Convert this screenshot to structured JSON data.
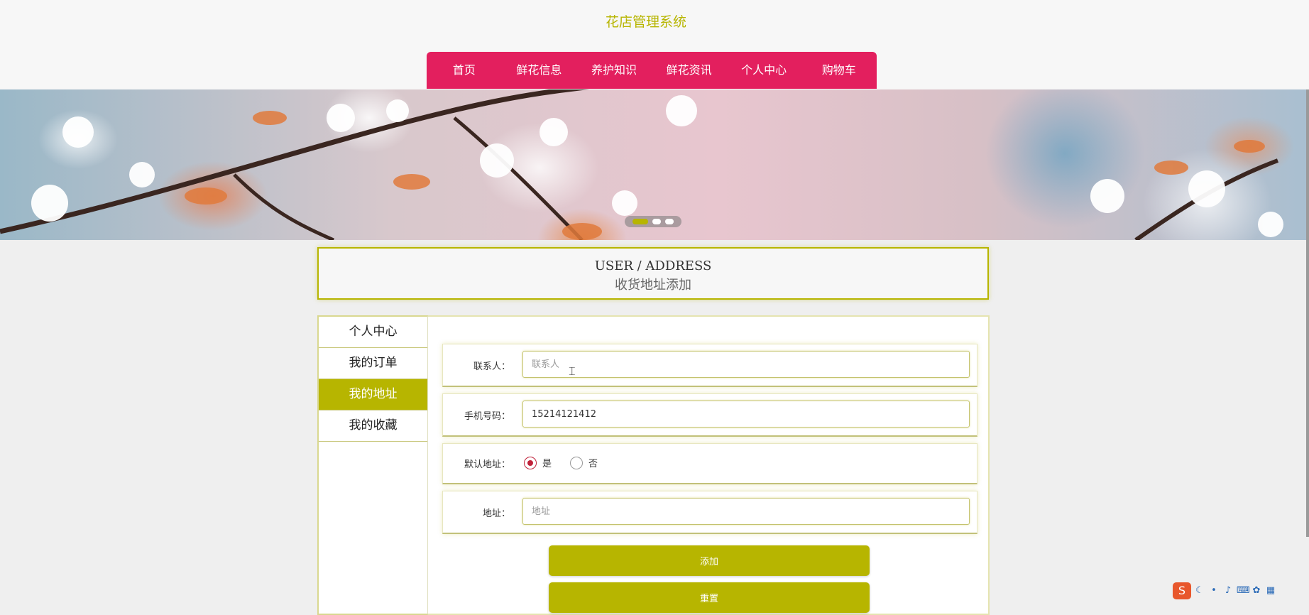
{
  "site": {
    "title": "花店管理系统"
  },
  "nav": {
    "items": [
      {
        "label": "首页"
      },
      {
        "label": "鲜花信息"
      },
      {
        "label": "养护知识"
      },
      {
        "label": "鲜花资讯"
      },
      {
        "label": "个人中心"
      },
      {
        "label": "购物车"
      }
    ]
  },
  "banner": {
    "slide_count": 3,
    "active_slide": 1
  },
  "page_header": {
    "en": "USER / ADDRESS",
    "cn": "收货地址添加"
  },
  "sidebar": {
    "items": [
      {
        "label": "个人中心",
        "active": false
      },
      {
        "label": "我的订单",
        "active": false
      },
      {
        "label": "我的地址",
        "active": true
      },
      {
        "label": "我的收藏",
        "active": false
      }
    ]
  },
  "form": {
    "contact": {
      "label": "联系人：",
      "value": "",
      "placeholder": "联系人"
    },
    "phone": {
      "label": "手机号码：",
      "value": "15214121412",
      "placeholder": ""
    },
    "default_address": {
      "label": "默认地址：",
      "options": [
        {
          "label": "是",
          "selected": true
        },
        {
          "label": "否",
          "selected": false
        }
      ]
    },
    "address": {
      "label": "地址：",
      "value": "",
      "placeholder": "地址"
    },
    "add_button": "添加",
    "reset_button": "重置"
  },
  "colors": {
    "accent": "#b7b500",
    "nav_bg": "#e31f5e",
    "radio_on": "#c0223a"
  }
}
